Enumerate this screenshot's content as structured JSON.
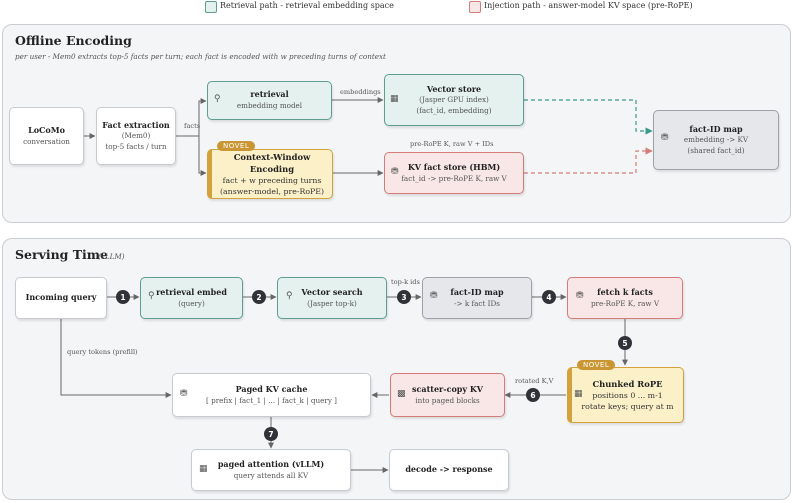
{
  "legend": {
    "retrieval": "Retrieval path - retrieval embedding space",
    "injection": "Injection path - answer-model KV space (pre-RoPE)"
  },
  "colors": {
    "retrieval_fill": "#e4f1ee",
    "retrieval_border": "#5e9d8f",
    "injection_fill": "#f8e7e6",
    "injection_border": "#d47c78",
    "novel_fill": "#fcf0c8",
    "novel_border": "#d4a23c",
    "neutral_fill": "#e6e7ea",
    "step_badge": "#2f3338"
  },
  "offline": {
    "title": "Offline Encoding",
    "subtitle": "per user - Mem0 extracts top-5 facts per turn; each fact is encoded with w preceding turns of context",
    "nodes": {
      "locomo": {
        "title": "LoCoMo",
        "sub": "conversation"
      },
      "fact_extraction": {
        "title": "Fact extraction",
        "sub1": "(Mem0)",
        "sub2": "top-5 facts / turn"
      },
      "retrieval": {
        "title": "retrieval",
        "sub": "embedding model"
      },
      "vector_store": {
        "title": "Vector store",
        "sub1": "(Jasper GPU index)",
        "sub2": "(fact_id, embedding)"
      },
      "factid_map": {
        "title": "fact-ID map",
        "sub1": "embedding -> KV",
        "sub2": "(shared fact_id)"
      },
      "cwe": {
        "badge": "NOVEL",
        "title": "Context-Window Encoding",
        "sub1": "fact + w preceding turns",
        "sub2": "(answer-model, pre-RoPE)"
      },
      "kv_store": {
        "title": "KV fact store (HBM)",
        "sub": "fact_id -> pre-RoPE K, raw V"
      }
    },
    "edges": {
      "facts": "facts",
      "embeddings": "embeddings",
      "prerope": "pre-RoPE K, raw V + IDs"
    }
  },
  "serving": {
    "title": "Serving Time",
    "subtitle": "(vLLM)",
    "nodes": {
      "incoming": {
        "title": "Incoming query"
      },
      "retrieval_embed": {
        "title": "retrieval embed",
        "sub": "(query)"
      },
      "vector_search": {
        "title": "Vector search",
        "sub": "(Jasper top-k)"
      },
      "factid_map": {
        "title": "fact-ID map",
        "sub": "-> k fact IDs"
      },
      "fetch": {
        "title": "fetch k facts",
        "sub": "pre-RoPE K, raw V"
      },
      "chunked_rope": {
        "badge": "NOVEL",
        "title": "Chunked RoPE",
        "sub1": "positions 0 ... m-1",
        "sub2": "rotate keys; query at m"
      },
      "scatter": {
        "title": "scatter-copy KV",
        "sub": "into paged blocks"
      },
      "paged_kv": {
        "title": "Paged KV cache",
        "sub": "[ prefix | fact_1 | ... | fact_k | query ]"
      },
      "paged_attn": {
        "title": "paged attention (vLLM)",
        "sub": "query attends all KV"
      },
      "decode": {
        "title": "decode -> response"
      }
    },
    "edges": {
      "topk": "top-k ids",
      "rotated": "rotated K,V",
      "query_tokens": "query tokens (prefill)"
    },
    "steps": [
      "1",
      "2",
      "3",
      "4",
      "5",
      "6",
      "7"
    ]
  }
}
